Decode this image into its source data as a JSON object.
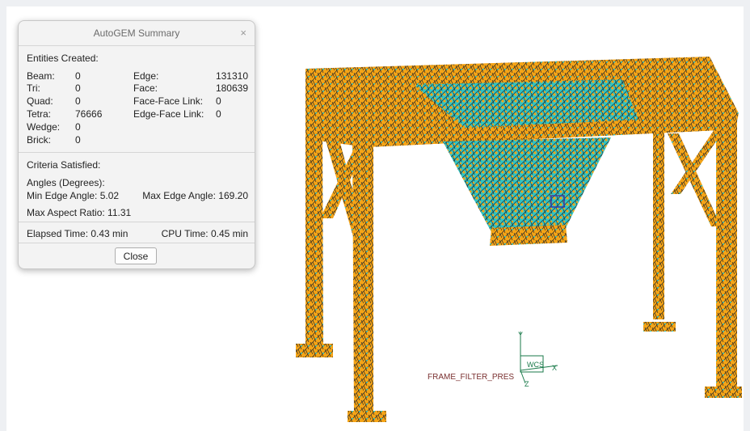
{
  "dialog": {
    "title": "AutoGEM Summary",
    "close_icon": "×",
    "entities_header": "Entities Created:",
    "entities_left": [
      {
        "label": "Beam:",
        "value": "0"
      },
      {
        "label": "Tri:",
        "value": "0"
      },
      {
        "label": "Quad:",
        "value": "0"
      },
      {
        "label": "Tetra:",
        "value": "76666"
      },
      {
        "label": "Wedge:",
        "value": "0"
      },
      {
        "label": "Brick:",
        "value": "0"
      }
    ],
    "entities_right": [
      {
        "label": "Edge:",
        "value": "131310"
      },
      {
        "label": "Face:",
        "value": "180639"
      },
      {
        "label": "Face-Face Link:",
        "value": "0"
      },
      {
        "label": "Edge-Face Link:",
        "value": "0"
      }
    ],
    "criteria_header": "Criteria Satisfied:",
    "angles_label": "Angles (Degrees):",
    "min_edge_angle": "Min Edge Angle:  5.02",
    "max_edge_angle": "Max Edge Angle: 169.20",
    "max_aspect_ratio": "Max Aspect Ratio: 11.31",
    "elapsed_time": "Elapsed Time: 0.43 min",
    "cpu_time": "CPU Time: 0.45 min",
    "close_button": "Close"
  },
  "model": {
    "label": "FRAME_FILTER_PRES",
    "csys_label": "WCS",
    "axis_x": "X",
    "axis_y": "Y",
    "axis_z": "Z",
    "mesh_color": "#f5a416",
    "mesh_accent_color": "#2ec4c4",
    "mesh_line_color": "#222222"
  },
  "icons": {
    "close": "close-icon"
  }
}
